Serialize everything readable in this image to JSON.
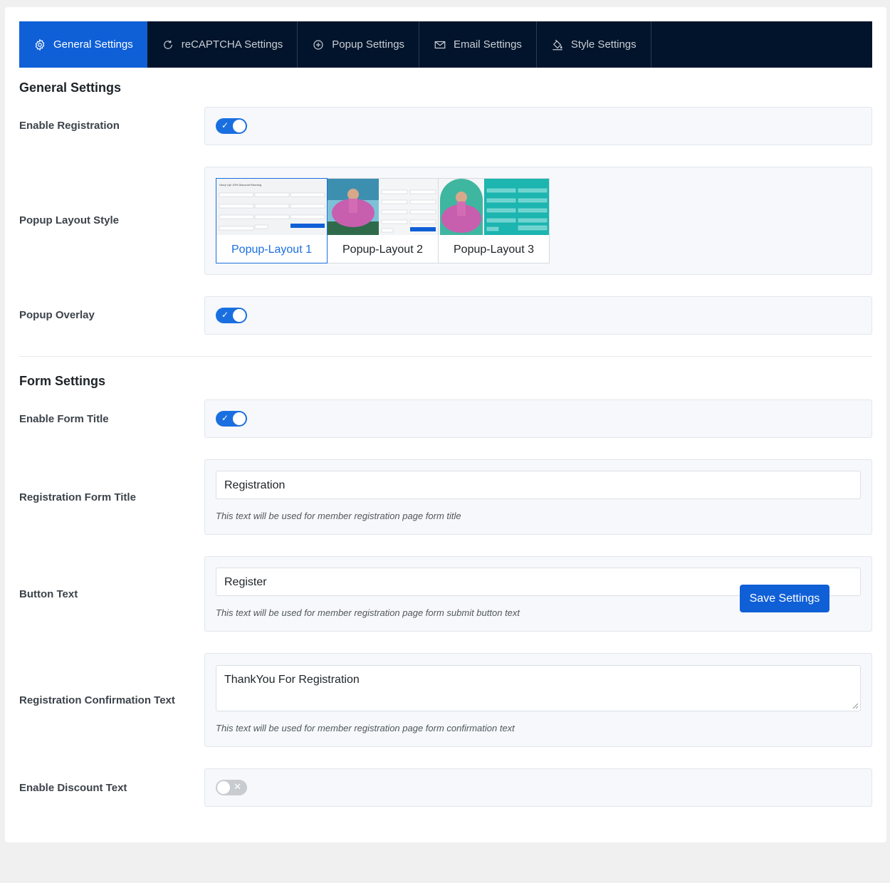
{
  "tabs": [
    {
      "label": "General Settings",
      "icon": "gear-icon",
      "active": true
    },
    {
      "label": "reCAPTCHA Settings",
      "icon": "refresh-icon",
      "active": false
    },
    {
      "label": "Popup Settings",
      "icon": "plus-circle-icon",
      "active": false
    },
    {
      "label": "Email Settings",
      "icon": "envelope-icon",
      "active": false
    },
    {
      "label": "Style Settings",
      "icon": "paint-bucket-icon",
      "active": false
    }
  ],
  "general": {
    "title": "General Settings",
    "enable_registration": {
      "label": "Enable Registration",
      "checked": true
    },
    "popup_layout": {
      "label": "Popup Layout Style",
      "options": [
        "Popup-Layout 1",
        "Popup-Layout 2",
        "Popup-Layout 3"
      ],
      "thumb_heading": "Hurry Up! 10% Discount Running",
      "thumb_button": "Register",
      "selected": "Popup-Layout 1"
    },
    "popup_overlay": {
      "label": "Popup Overlay",
      "checked": true
    }
  },
  "form": {
    "title": "Form Settings",
    "enable_form_title": {
      "label": "Enable Form Title",
      "checked": true
    },
    "registration_form_title": {
      "label": "Registration Form Title",
      "value": "Registration",
      "help": "This text will be used for member registration page form title"
    },
    "button_text": {
      "label": "Button Text",
      "value": "Register",
      "help": "This text will be used for member registration page form submit button text"
    },
    "confirmation_text": {
      "label": "Registration Confirmation Text",
      "value": "ThankYou For Registration",
      "help": "This text will be used for member registration page form confirmation text"
    },
    "enable_discount_text": {
      "label": "Enable Discount Text",
      "checked": false
    }
  },
  "save_button": "Save Settings",
  "colors": {
    "accent": "#0f5fd7",
    "nav_bg": "#02142b",
    "teal": "#1cb5b0"
  }
}
